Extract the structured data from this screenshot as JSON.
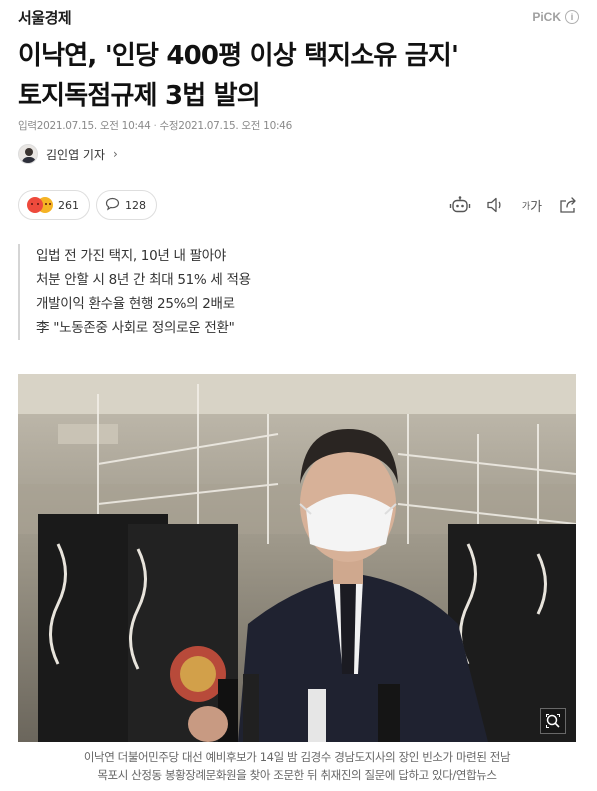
{
  "header": {
    "press_name": "서울경제",
    "pick_label": "PiCK",
    "pick_info_icon": "i"
  },
  "article": {
    "headline_line1": "이낙연, '인당 400평 이상 택지소유 금지'",
    "headline_line2": "토지독점규제 3법 발의",
    "input_label": "입력",
    "input_date": "2021.07.15. 오전 10:44",
    "separator": "·",
    "modified_label": "수정",
    "modified_date": "2021.07.15. 오전 10:46",
    "reporter": "김인엽 기자",
    "reporter_chevron": "›"
  },
  "reactions": {
    "reaction_count": "261",
    "comment_count": "128"
  },
  "toolbar": {
    "font_size_label": "가"
  },
  "summary": [
    "입법 전 가진 택지, 10년 내 팔아야",
    "처분 안할 시 8년 간 최대 51% 세 적용",
    "개발이익 환수율 현행 25%의 2배로",
    "李 \"노동존중 사회로 정의로운 전환\""
  ],
  "photo": {
    "caption_line1": "이낙연 더불어민주당 대선 예비후보가 14일 밤 김경수 경남도지사의 장인 빈소가 마련된 전남",
    "caption_line2": "목포시 산정동 봉황장례문화원을 찾아 조문한 뒤 취재진의 질문에 답하고 있다/연합뉴스"
  },
  "icons": {
    "reaction": "angry-emoji-icon",
    "comment": "speech-bubble-icon",
    "tts": "robot-icon",
    "audio": "speaker-icon",
    "font": "font-size-icon",
    "share": "share-icon",
    "zoom": "magnifier-icon"
  },
  "colors": {
    "reaction_red": "#ee4a3c",
    "reaction_yellow": "#f5b324"
  }
}
